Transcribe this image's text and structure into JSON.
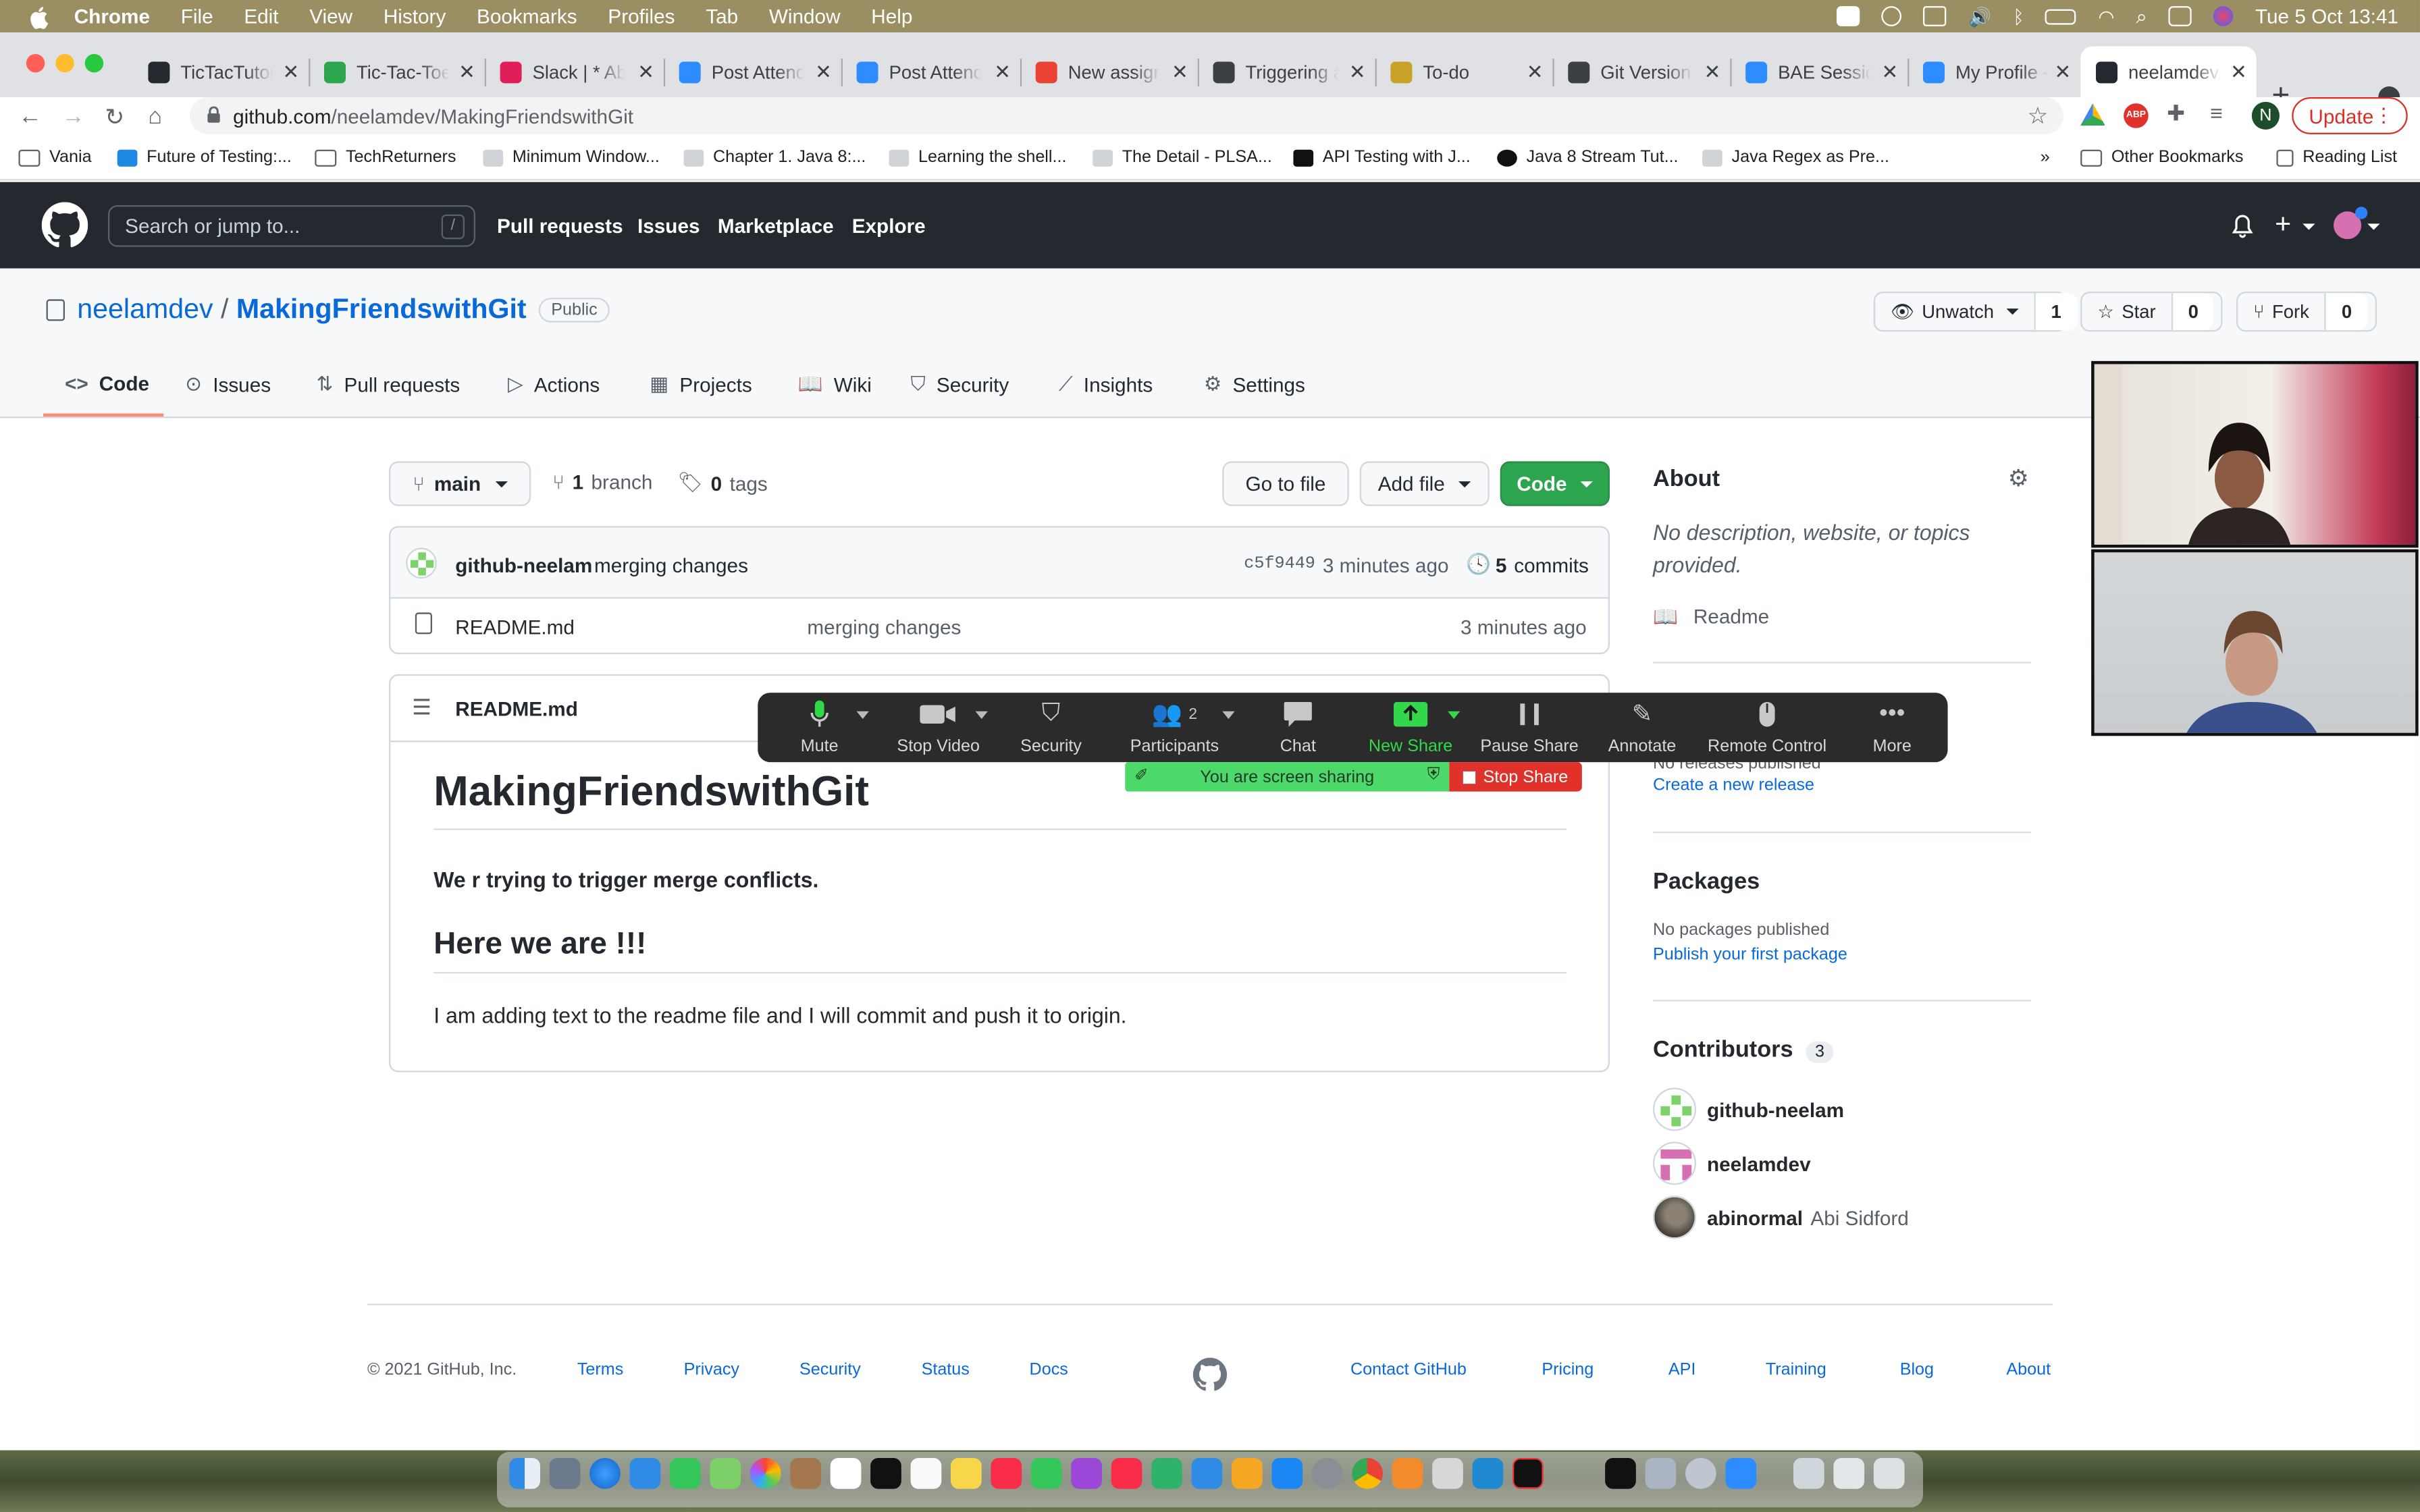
{
  "menubar": {
    "app": "Chrome",
    "items": [
      "File",
      "Edit",
      "View",
      "History",
      "Bookmarks",
      "Profiles",
      "Tab",
      "Window",
      "Help"
    ],
    "datetime": "Tue 5 Oct  13:41"
  },
  "tabs": [
    {
      "label": "TicTacTutori",
      "icon": "github-icon",
      "color": "#24292f"
    },
    {
      "label": "Tic-Tac-Toe",
      "icon": "link-icon",
      "color": "#2da44e"
    },
    {
      "label": "Slack | * Abi",
      "icon": "slack-icon",
      "color": "#e01e5a"
    },
    {
      "label": "Post Attende",
      "icon": "zoom-icon",
      "color": "#2d8cff"
    },
    {
      "label": "Post Attende",
      "icon": "zoom-icon",
      "color": "#2d8cff"
    },
    {
      "label": "New assignm",
      "icon": "gmail-icon",
      "color": "#ea4335"
    },
    {
      "label": "Triggering a",
      "icon": "page-icon",
      "color": "#3c4043"
    },
    {
      "label": "To-do",
      "icon": "todo-icon",
      "color": "#c9a227"
    },
    {
      "label": "Git Version",
      "icon": "page-icon",
      "color": "#3c4043"
    },
    {
      "label": "BAE Session",
      "icon": "zoom-icon",
      "color": "#2d8cff"
    },
    {
      "label": "My Profile -",
      "icon": "zoom-icon",
      "color": "#2d8cff"
    },
    {
      "label": "neelamdev/M",
      "icon": "github-icon",
      "color": "#24292f",
      "active": true
    }
  ],
  "toolbar": {
    "url_host": "github.com",
    "url_path": "/neelamdev/MakingFriendswithGit",
    "profile_initial": "N",
    "update_label": "Update"
  },
  "bookmarks": [
    {
      "label": "Vania",
      "icon": "folder-icon"
    },
    {
      "label": "Future of Testing:...",
      "icon": "cloud-icon"
    },
    {
      "label": "TechReturners",
      "icon": "folder-icon"
    },
    {
      "label": "Minimum Window...",
      "icon": "bookmark-icon"
    },
    {
      "label": "Chapter 1. Java 8:...",
      "icon": "bookmark-icon"
    },
    {
      "label": "Learning the shell...",
      "icon": "bookmark-icon"
    },
    {
      "label": "The Detail - PLSA...",
      "icon": "bookmark-icon"
    },
    {
      "label": "API Testing with J...",
      "icon": "dev-icon"
    },
    {
      "label": "Java 8 Stream Tut...",
      "icon": "w-icon"
    },
    {
      "label": "Java Regex as Pre...",
      "icon": "bookmark-icon"
    }
  ],
  "bookmarks_more": "»",
  "bookmarks_other": "Other Bookmarks",
  "bookmarks_reading": "Reading List",
  "gh": {
    "search_placeholder": "Search or jump to...",
    "search_key": "/",
    "nav": [
      "Pull requests",
      "Issues",
      "Marketplace",
      "Explore"
    ],
    "owner": "neelamdev",
    "repo": "MakingFriendswithGit",
    "visibility": "Public",
    "unwatch_label": "Unwatch",
    "unwatch_count": "1",
    "star_label": "Star",
    "star_count": "0",
    "fork_label": "Fork",
    "fork_count": "0",
    "repo_tabs": [
      "Code",
      "Issues",
      "Pull requests",
      "Actions",
      "Projects",
      "Wiki",
      "Security",
      "Insights",
      "Settings"
    ],
    "branch": "main",
    "branch_count": "1",
    "branch_word": "branch",
    "tag_count": "0",
    "tag_word": "tags",
    "goto_file": "Go to file",
    "add_file": "Add file",
    "code_btn": "Code",
    "commit": {
      "author": "github-neelam",
      "message": "merging changes",
      "sha": "c5f9449",
      "time": "3 minutes ago",
      "count": "5",
      "count_word": "commits"
    },
    "files": [
      {
        "name": "README.md",
        "message": "merging changes",
        "time": "3 minutes ago"
      }
    ],
    "readme": {
      "filename": "README.md",
      "h1": "MakingFriendswithGit",
      "bold_p": "We r trying to trigger merge conflicts.",
      "h2": "Here we are !!!",
      "p": "I am adding text to the readme file and I will commit and push it to origin."
    },
    "about": {
      "heading": "About",
      "desc": "No description, website, or topics provided.",
      "readme_link": "Readme"
    },
    "releases": {
      "empty": "No releases published",
      "create": "Create a new release"
    },
    "packages": {
      "heading": "Packages",
      "empty": "No packages published",
      "publish": "Publish your first package"
    },
    "contributors": {
      "heading": "Contributors",
      "count": "3",
      "list": [
        {
          "login": "github-neelam",
          "name": ""
        },
        {
          "login": "neelamdev",
          "name": ""
        },
        {
          "login": "abinormal",
          "name": "Abi Sidford"
        }
      ]
    },
    "footer": {
      "copyright": "© 2021 GitHub, Inc.",
      "left_links": [
        "Terms",
        "Privacy",
        "Security",
        "Status",
        "Docs"
      ],
      "right_links": [
        "Contact GitHub",
        "Pricing",
        "API",
        "Training",
        "Blog",
        "About"
      ]
    }
  },
  "zoom": {
    "buttons": [
      {
        "label": "Mute",
        "icon": "microphone-icon"
      },
      {
        "label": "Stop Video",
        "icon": "video-camera-icon"
      },
      {
        "label": "Security",
        "icon": "shield-icon"
      },
      {
        "label": "Participants",
        "icon": "participants-icon",
        "badge": "2"
      },
      {
        "label": "Chat",
        "icon": "chat-icon"
      },
      {
        "label": "New Share",
        "icon": "share-screen-icon"
      },
      {
        "label": "Pause Share",
        "icon": "pause-icon"
      },
      {
        "label": "Annotate",
        "icon": "pencil-icon"
      },
      {
        "label": "Remote Control",
        "icon": "mouse-icon"
      },
      {
        "label": "More",
        "icon": "more-dots-icon"
      }
    ],
    "sharing_text": "You are screen sharing",
    "stop_share": "Stop Share"
  },
  "colors": {
    "gh_header": "#24292f",
    "link": "#0969da",
    "green_btn": "#2da44e",
    "zoom_green": "#32d74b",
    "stop_red": "#e0322b"
  }
}
